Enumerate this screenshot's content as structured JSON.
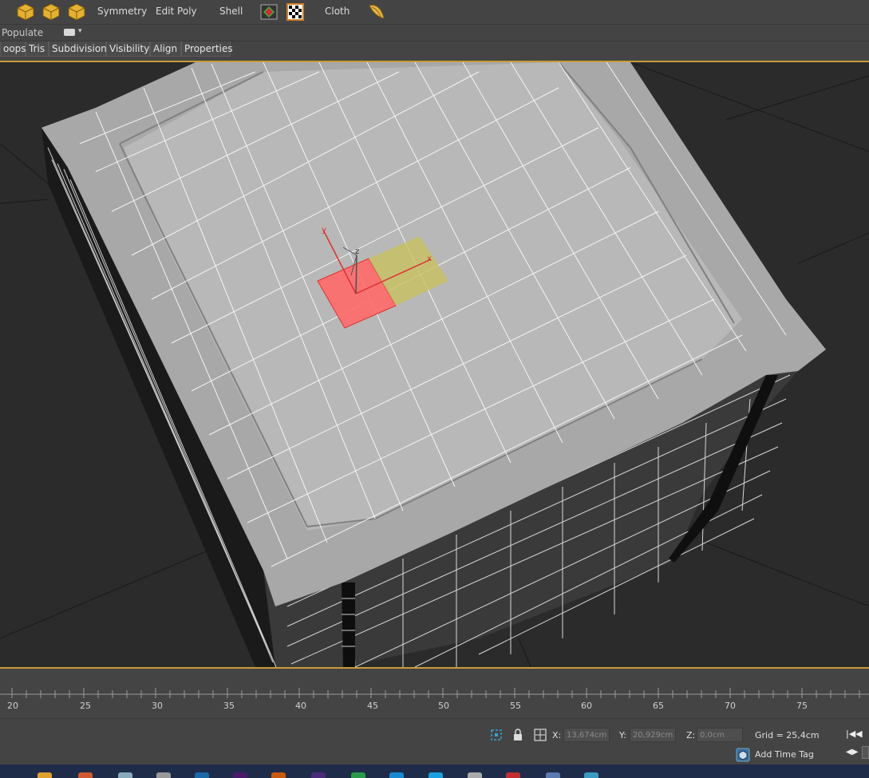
{
  "toolbar": {
    "symmetry": "Symmetry",
    "edit_poly": "Edit Poly",
    "shell": "Shell",
    "cloth": "Cloth"
  },
  "ribbon": {
    "populate": "Populate"
  },
  "tabs": [
    "oops",
    "Tris",
    "Subdivision",
    "Visibility",
    "Align",
    "Properties"
  ],
  "viewport": {
    "axis_y": "y",
    "axis_z": "z",
    "axis_x": "x"
  },
  "timeline": {
    "ticks": [
      "20",
      "25",
      "30",
      "35",
      "40",
      "45",
      "50",
      "55",
      "60",
      "65",
      "70",
      "75"
    ]
  },
  "status": {
    "x_label": "X:",
    "x_value": "13,674cm",
    "y_label": "Y:",
    "y_value": "20,929cm",
    "z_label": "Z:",
    "z_value": "0,0cm",
    "grid": "Grid = 25,4cm",
    "add_time_tag": "Add Time Tag"
  },
  "colors": {
    "accent": "#c79c3a",
    "selection_red": "#ff6a6a",
    "gizmo_plane": "#c8c060"
  }
}
